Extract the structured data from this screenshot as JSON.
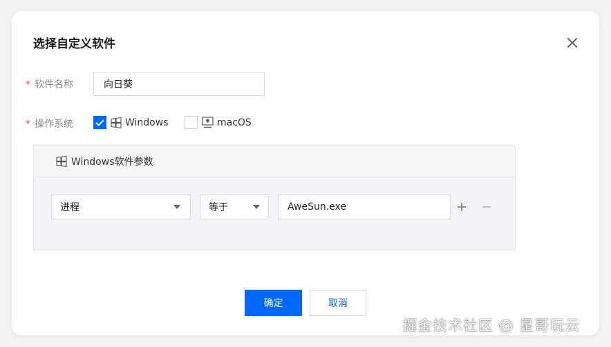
{
  "dialog": {
    "title": "选择自定义软件"
  },
  "form": {
    "required_mark": "*",
    "name_label": "软件名称",
    "name_value": "向日葵",
    "os_label": "操作系统",
    "os_options": [
      {
        "label": "Windows",
        "checked": true,
        "icon": "windows-icon"
      },
      {
        "label": "macOS",
        "checked": false,
        "icon": "mac-monitor-icon"
      }
    ]
  },
  "panel": {
    "title": "Windows软件参数",
    "icon": "windows-icon",
    "rule": {
      "field": "进程",
      "operator": "等于",
      "value": "AweSun.exe"
    }
  },
  "buttons": {
    "confirm": "确定",
    "cancel": "取消"
  },
  "watermark": "掘金技术社区 @ 星哥玩云",
  "colors": {
    "primary": "#0067ff",
    "required": "#e54545",
    "background": "#f2f3f5"
  }
}
